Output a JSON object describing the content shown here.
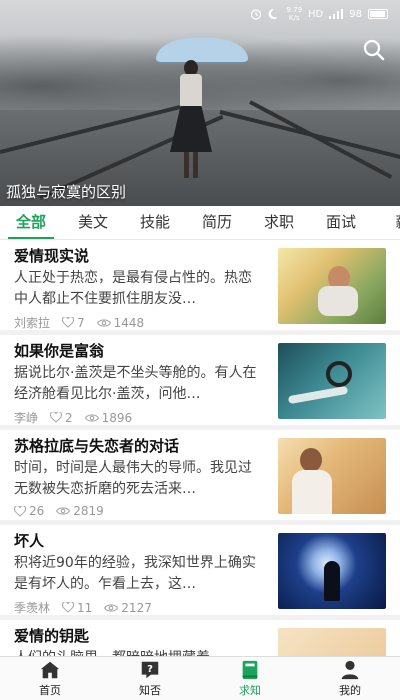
{
  "status": {
    "speed": "9.79\nK/s",
    "network": "HD",
    "battery": "98"
  },
  "banner": {
    "caption": "孤独与寂寞的区别"
  },
  "tabs": [
    "全部",
    "美文",
    "技能",
    "简历",
    "求职",
    "面试",
    "薪"
  ],
  "active_tab": 0,
  "articles": [
    {
      "title": "爱情现实说",
      "summary": "人正处于热恋，是最有侵占性的。热恋中人都止不住要抓住朋友没…",
      "author": "刘索拉",
      "likes": "7",
      "views": "1448"
    },
    {
      "title": "如果你是富翁",
      "summary": "据说比尔·盖茨是不坐头等舱的。有人在经济舱看见比尔·盖茨，问他…",
      "author": "李峥",
      "likes": "2",
      "views": "1896"
    },
    {
      "title": "苏格拉底与失恋者的对话",
      "summary": "时间，时间是人最伟大的导师。我见过无数被失恋折磨的死去活来…",
      "author": "",
      "likes": "26",
      "views": "2819"
    },
    {
      "title": "坏人",
      "summary": "积将近90年的经验，我深知世界上确实是有坏人的。乍看上去，这…",
      "author": "季羡林",
      "likes": "11",
      "views": "2127"
    },
    {
      "title": "爱情的钥匙",
      "summary": "人们的头脑里，都暗暗地埋藏着…",
      "author": "",
      "likes": "",
      "views": ""
    }
  ],
  "nav": [
    {
      "label": "首页",
      "icon": "home-icon"
    },
    {
      "label": "知否",
      "icon": "question-icon"
    },
    {
      "label": "求知",
      "icon": "book-icon"
    },
    {
      "label": "我的",
      "icon": "user-icon"
    }
  ],
  "colors": {
    "accent": "#1ea35b"
  }
}
